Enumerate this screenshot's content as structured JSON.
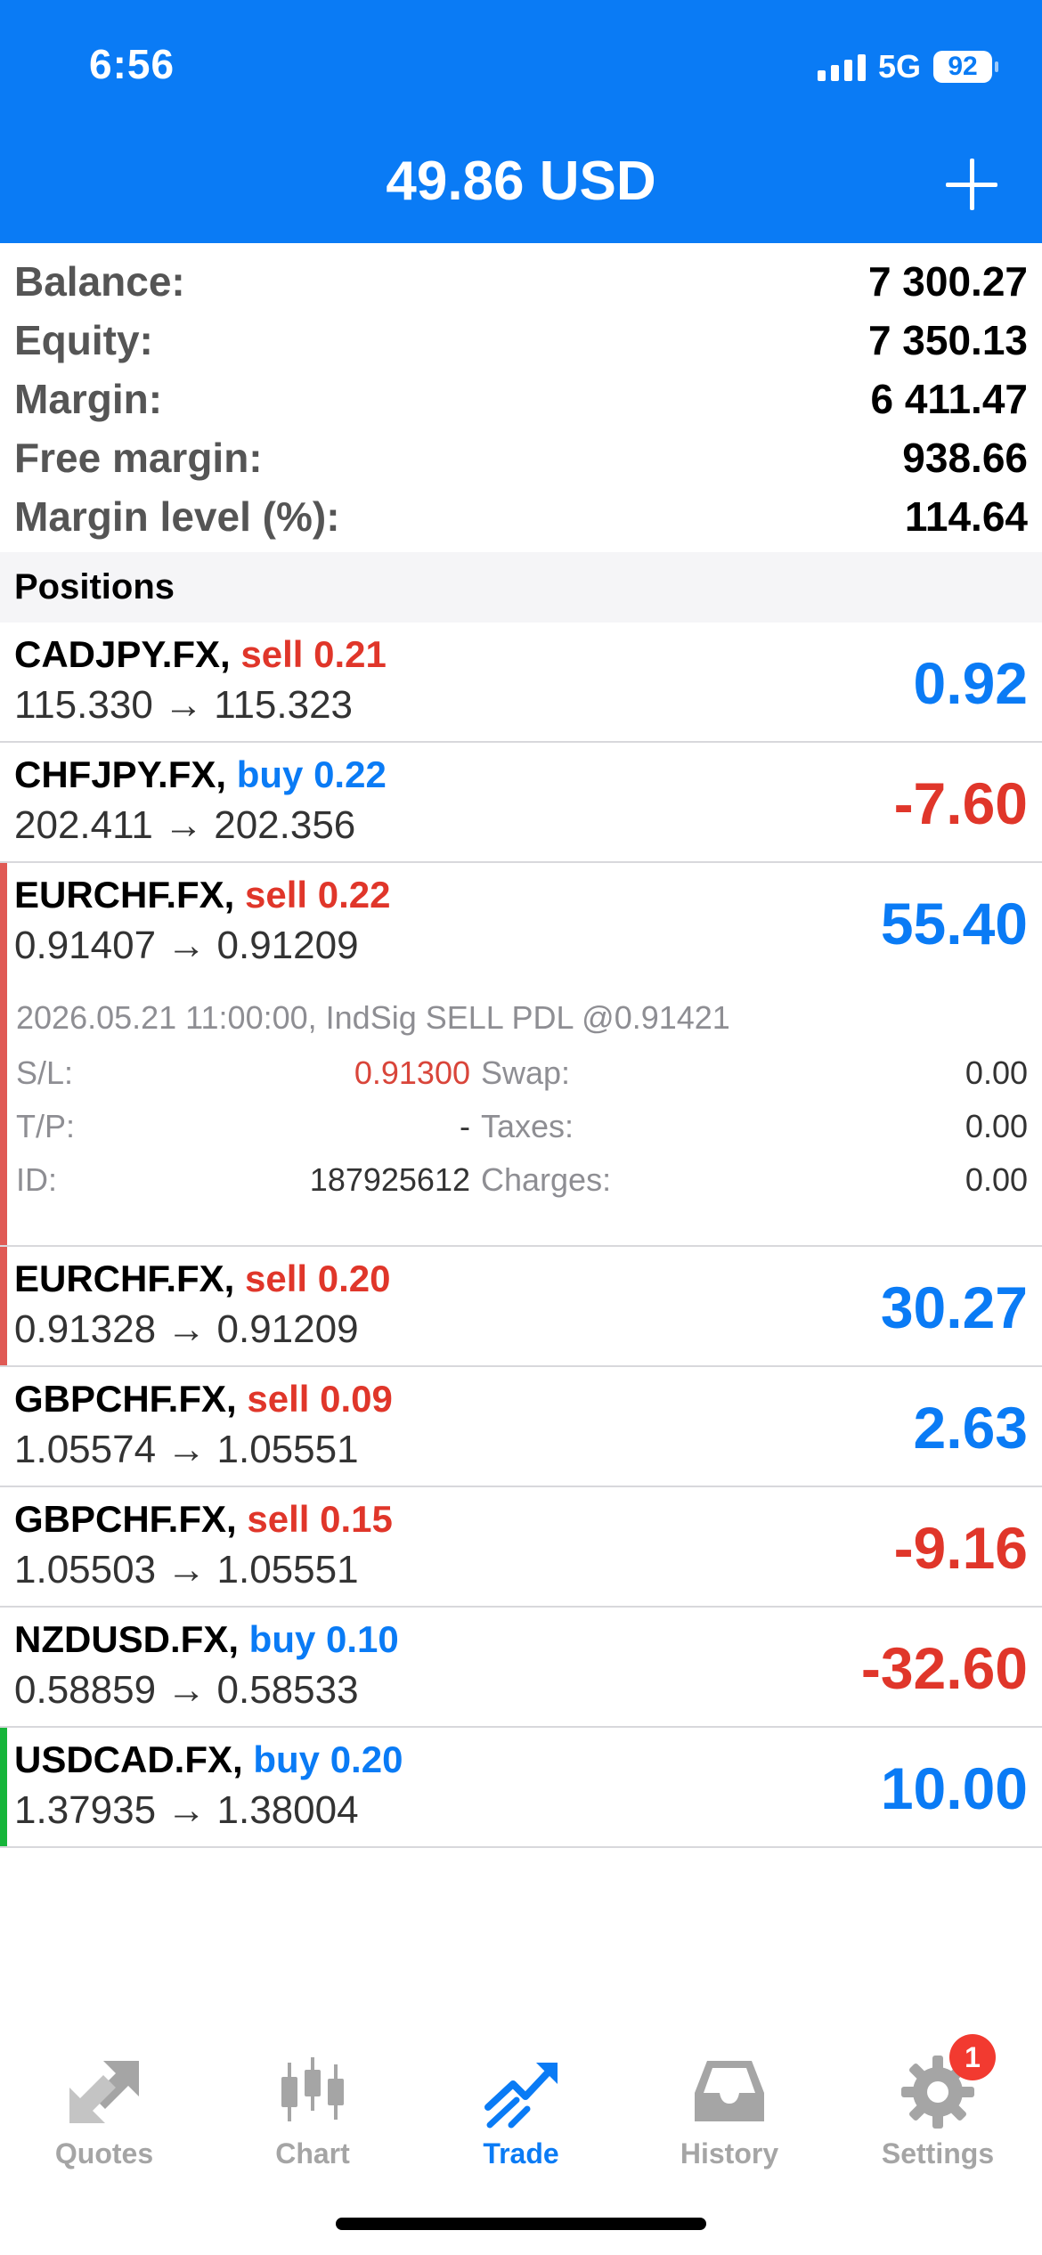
{
  "status": {
    "time": "6:56",
    "network": "5G",
    "battery": "92"
  },
  "header": {
    "title": "49.86 USD"
  },
  "summary": [
    {
      "label": "Balance:",
      "value": "7 300.27"
    },
    {
      "label": "Equity:",
      "value": "7 350.13"
    },
    {
      "label": "Margin:",
      "value": "6 411.47"
    },
    {
      "label": "Free margin:",
      "value": "938.66"
    },
    {
      "label": "Margin level (%):",
      "value": "114.64"
    }
  ],
  "positions_header": "Positions",
  "positions": [
    {
      "symbol": "CADJPY.FX,",
      "side": "sell 0.21",
      "price": "115.330 → 115.323",
      "profit": "0.92"
    },
    {
      "symbol": "CHFJPY.FX,",
      "side": "buy 0.22",
      "price": "202.411 → 202.356",
      "profit": "-7.60"
    },
    {
      "symbol": "EURCHF.FX,",
      "side": "sell 0.22",
      "price": "0.91407 → 0.91209",
      "profit": "55.40"
    },
    {
      "symbol": "EURCHF.FX,",
      "side": "sell 0.20",
      "price": "0.91328 → 0.91209",
      "profit": "30.27"
    },
    {
      "symbol": "GBPCHF.FX,",
      "side": "sell 0.09",
      "price": "1.05574 → 1.05551",
      "profit": "2.63"
    },
    {
      "symbol": "GBPCHF.FX,",
      "side": "sell 0.15",
      "price": "1.05503 → 1.05551",
      "profit": "-9.16"
    },
    {
      "symbol": "NZDUSD.FX,",
      "side": "buy 0.10",
      "price": "0.58859 → 0.58533",
      "profit": "-32.60"
    },
    {
      "symbol": "USDCAD.FX,",
      "side": "buy 0.20",
      "price": "1.37935 → 1.38004",
      "profit": "10.00"
    }
  ],
  "expanded_details": {
    "note": "2026.05.21 11:00:00, IndSig SELL PDL @0.91421",
    "sl_label": "S/L:",
    "sl_value": "0.91300",
    "swap_label": "Swap:",
    "swap_value": "0.00",
    "tp_label": "T/P:",
    "tp_value": "-",
    "taxes_label": "Taxes:",
    "taxes_value": "0.00",
    "id_label": "ID:",
    "id_value": "187925612",
    "charges_label": "Charges:",
    "charges_value": "0.00"
  },
  "tabs": [
    {
      "label": "Quotes",
      "icon": "quotes-arrows-icon"
    },
    {
      "label": "Chart",
      "icon": "candlestick-icon"
    },
    {
      "label": "Trade",
      "icon": "trend-up-icon"
    },
    {
      "label": "History",
      "icon": "inbox-tray-icon"
    },
    {
      "label": "Settings",
      "icon": "gear-icon",
      "badge": "1"
    }
  ],
  "colors": {
    "accent": "#0a7bf5",
    "loss": "#e0362a",
    "buy_marker": "#16b53a",
    "sell_marker": "#e05a55"
  }
}
